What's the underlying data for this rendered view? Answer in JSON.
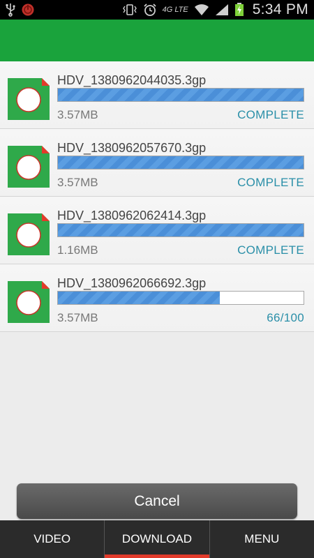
{
  "status_bar": {
    "time": "5:34 PM",
    "network_label": "4G LTE",
    "icons": [
      "usb-icon",
      "notification-icon",
      "vibrate-icon",
      "alarm-icon",
      "lte-icon",
      "wifi-icon",
      "signal-icon",
      "battery-charging-icon"
    ]
  },
  "colors": {
    "action_bar": "#1aa33c",
    "progress": "#4b8fd8",
    "status_text": "#2a8fa8",
    "active_tab": "#e23a2a"
  },
  "downloads": [
    {
      "name": "HDV_1380962044035.3gp",
      "size": "3.57MB",
      "status": "COMPLETE",
      "progress": 1.0
    },
    {
      "name": "HDV_1380962057670.3gp",
      "size": "3.57MB",
      "status": "COMPLETE",
      "progress": 1.0
    },
    {
      "name": "HDV_1380962062414.3gp",
      "size": "1.16MB",
      "status": "COMPLETE",
      "progress": 1.0
    },
    {
      "name": "HDV_1380962066692.3gp",
      "size": "3.57MB",
      "status": "66/100",
      "progress": 0.66
    }
  ],
  "cancel_label": "Cancel",
  "tabs": [
    {
      "label": "VIDEO",
      "active": false
    },
    {
      "label": "DOWNLOAD",
      "active": true
    },
    {
      "label": "MENU",
      "active": false
    }
  ]
}
